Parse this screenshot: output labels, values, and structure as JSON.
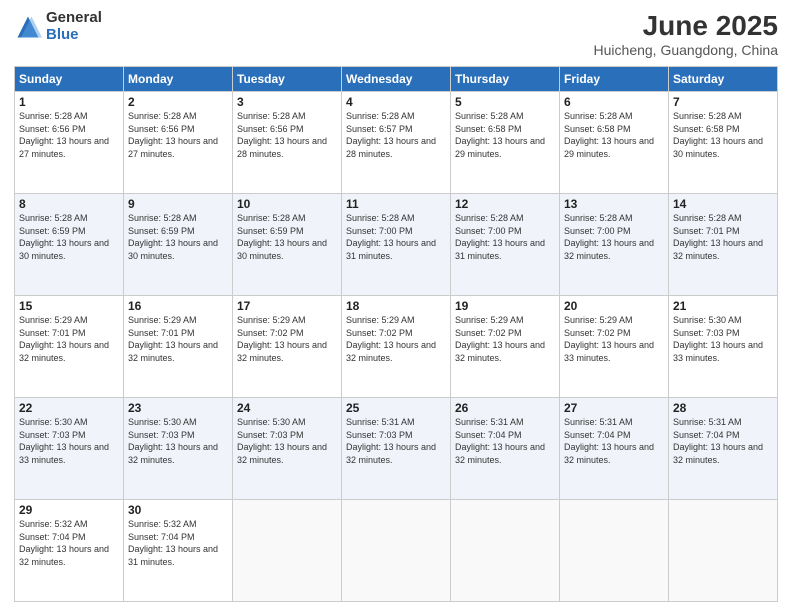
{
  "logo": {
    "general": "General",
    "blue": "Blue"
  },
  "title": "June 2025",
  "subtitle": "Huicheng, Guangdong, China",
  "weekdays": [
    "Sunday",
    "Monday",
    "Tuesday",
    "Wednesday",
    "Thursday",
    "Friday",
    "Saturday"
  ],
  "weeks": [
    [
      {
        "day": "1",
        "sunrise": "5:28 AM",
        "sunset": "6:56 PM",
        "daylight": "13 hours and 27 minutes."
      },
      {
        "day": "2",
        "sunrise": "5:28 AM",
        "sunset": "6:56 PM",
        "daylight": "13 hours and 27 minutes."
      },
      {
        "day": "3",
        "sunrise": "5:28 AM",
        "sunset": "6:56 PM",
        "daylight": "13 hours and 28 minutes."
      },
      {
        "day": "4",
        "sunrise": "5:28 AM",
        "sunset": "6:57 PM",
        "daylight": "13 hours and 28 minutes."
      },
      {
        "day": "5",
        "sunrise": "5:28 AM",
        "sunset": "6:58 PM",
        "daylight": "13 hours and 29 minutes."
      },
      {
        "day": "6",
        "sunrise": "5:28 AM",
        "sunset": "6:58 PM",
        "daylight": "13 hours and 29 minutes."
      },
      {
        "day": "7",
        "sunrise": "5:28 AM",
        "sunset": "6:58 PM",
        "daylight": "13 hours and 30 minutes."
      }
    ],
    [
      {
        "day": "8",
        "sunrise": "5:28 AM",
        "sunset": "6:59 PM",
        "daylight": "13 hours and 30 minutes."
      },
      {
        "day": "9",
        "sunrise": "5:28 AM",
        "sunset": "6:59 PM",
        "daylight": "13 hours and 30 minutes."
      },
      {
        "day": "10",
        "sunrise": "5:28 AM",
        "sunset": "6:59 PM",
        "daylight": "13 hours and 30 minutes."
      },
      {
        "day": "11",
        "sunrise": "5:28 AM",
        "sunset": "7:00 PM",
        "daylight": "13 hours and 31 minutes."
      },
      {
        "day": "12",
        "sunrise": "5:28 AM",
        "sunset": "7:00 PM",
        "daylight": "13 hours and 31 minutes."
      },
      {
        "day": "13",
        "sunrise": "5:28 AM",
        "sunset": "7:00 PM",
        "daylight": "13 hours and 32 minutes."
      },
      {
        "day": "14",
        "sunrise": "5:28 AM",
        "sunset": "7:01 PM",
        "daylight": "13 hours and 32 minutes."
      }
    ],
    [
      {
        "day": "15",
        "sunrise": "5:29 AM",
        "sunset": "7:01 PM",
        "daylight": "13 hours and 32 minutes."
      },
      {
        "day": "16",
        "sunrise": "5:29 AM",
        "sunset": "7:01 PM",
        "daylight": "13 hours and 32 minutes."
      },
      {
        "day": "17",
        "sunrise": "5:29 AM",
        "sunset": "7:02 PM",
        "daylight": "13 hours and 32 minutes."
      },
      {
        "day": "18",
        "sunrise": "5:29 AM",
        "sunset": "7:02 PM",
        "daylight": "13 hours and 32 minutes."
      },
      {
        "day": "19",
        "sunrise": "5:29 AM",
        "sunset": "7:02 PM",
        "daylight": "13 hours and 32 minutes."
      },
      {
        "day": "20",
        "sunrise": "5:29 AM",
        "sunset": "7:02 PM",
        "daylight": "13 hours and 33 minutes."
      },
      {
        "day": "21",
        "sunrise": "5:30 AM",
        "sunset": "7:03 PM",
        "daylight": "13 hours and 33 minutes."
      }
    ],
    [
      {
        "day": "22",
        "sunrise": "5:30 AM",
        "sunset": "7:03 PM",
        "daylight": "13 hours and 33 minutes."
      },
      {
        "day": "23",
        "sunrise": "5:30 AM",
        "sunset": "7:03 PM",
        "daylight": "13 hours and 32 minutes."
      },
      {
        "day": "24",
        "sunrise": "5:30 AM",
        "sunset": "7:03 PM",
        "daylight": "13 hours and 32 minutes."
      },
      {
        "day": "25",
        "sunrise": "5:31 AM",
        "sunset": "7:03 PM",
        "daylight": "13 hours and 32 minutes."
      },
      {
        "day": "26",
        "sunrise": "5:31 AM",
        "sunset": "7:04 PM",
        "daylight": "13 hours and 32 minutes."
      },
      {
        "day": "27",
        "sunrise": "5:31 AM",
        "sunset": "7:04 PM",
        "daylight": "13 hours and 32 minutes."
      },
      {
        "day": "28",
        "sunrise": "5:31 AM",
        "sunset": "7:04 PM",
        "daylight": "13 hours and 32 minutes."
      }
    ],
    [
      {
        "day": "29",
        "sunrise": "5:32 AM",
        "sunset": "7:04 PM",
        "daylight": "13 hours and 32 minutes."
      },
      {
        "day": "30",
        "sunrise": "5:32 AM",
        "sunset": "7:04 PM",
        "daylight": "13 hours and 31 minutes."
      },
      null,
      null,
      null,
      null,
      null
    ]
  ]
}
